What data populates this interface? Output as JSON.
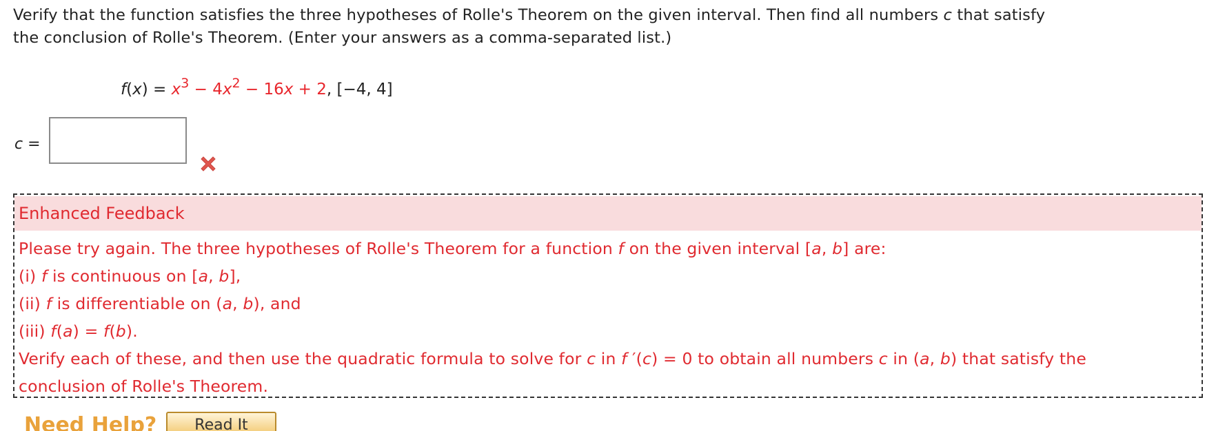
{
  "question": {
    "line1_a": "Verify that the function satisfies the three hypotheses of Rolle's Theorem on the given interval. Then find all numbers ",
    "line1_var": "c",
    "line1_b": " that satisfy",
    "line2": "the conclusion of Rolle's Theorem. (Enter your answers as a comma-separated list.)"
  },
  "equation": {
    "fx": "f",
    "paren_open": "(",
    "x": "x",
    "paren_close_eq": ") = ",
    "term1_var": "x",
    "term1_exp": "3",
    "term2": " − 4",
    "term2_var": "x",
    "term2_exp": "2",
    "term3": " − 16",
    "term3_var": "x",
    "term4": " + 2",
    "interval": ",  [−4, 4]"
  },
  "answer": {
    "label_var": "c",
    "label_eq": " =",
    "value": "",
    "status_icon": "wrong-x-icon",
    "status_color": "#e0574f"
  },
  "feedback": {
    "title": "Enhanced Feedback",
    "line1_a": "Please try again. The three hypotheses of Rolle's Theorem for a function ",
    "line1_f": "f",
    "line1_b": " on the given interval [",
    "line1_a_var": "a",
    "line1_comma": ", ",
    "line1_b_var": "b",
    "line1_end": "] are:",
    "item1_pre": "(i) ",
    "item1_f": "f",
    "item1_mid": " is continuous on [",
    "item1_a": "a",
    "item1_comma": ", ",
    "item1_b": "b",
    "item1_end": "],",
    "item2_pre": "(ii) ",
    "item2_f": "f",
    "item2_mid": " is differentiable on (",
    "item2_a": "a",
    "item2_comma": ", ",
    "item2_b": "b",
    "item2_end": "), and",
    "item3_pre": "(iii) ",
    "item3_f1": "f",
    "item3_a_open": "(",
    "item3_a": "a",
    "item3_eq": ") = ",
    "item3_f2": "f",
    "item3_b_open": "(",
    "item3_b": "b",
    "item3_end": ").",
    "verify_a": "Verify each of these, and then use the quadratic formula to solve for ",
    "verify_c": "c",
    "verify_in": " in ",
    "verify_f": "f",
    "verify_prime": " ′(",
    "verify_c2": "c",
    "verify_eq": ") = 0 to obtain all numbers ",
    "verify_c3": "c",
    "verify_in2": " in (",
    "verify_a_var": "a",
    "verify_comma": ", ",
    "verify_b_var": "b",
    "verify_end": ") that satisfy the",
    "last_line": "conclusion of Rolle's Theorem.",
    "text_color": "#e02a30",
    "header_bg": "#f9dcdd"
  },
  "help": {
    "label": "Need Help?",
    "read_button": "Read It"
  }
}
